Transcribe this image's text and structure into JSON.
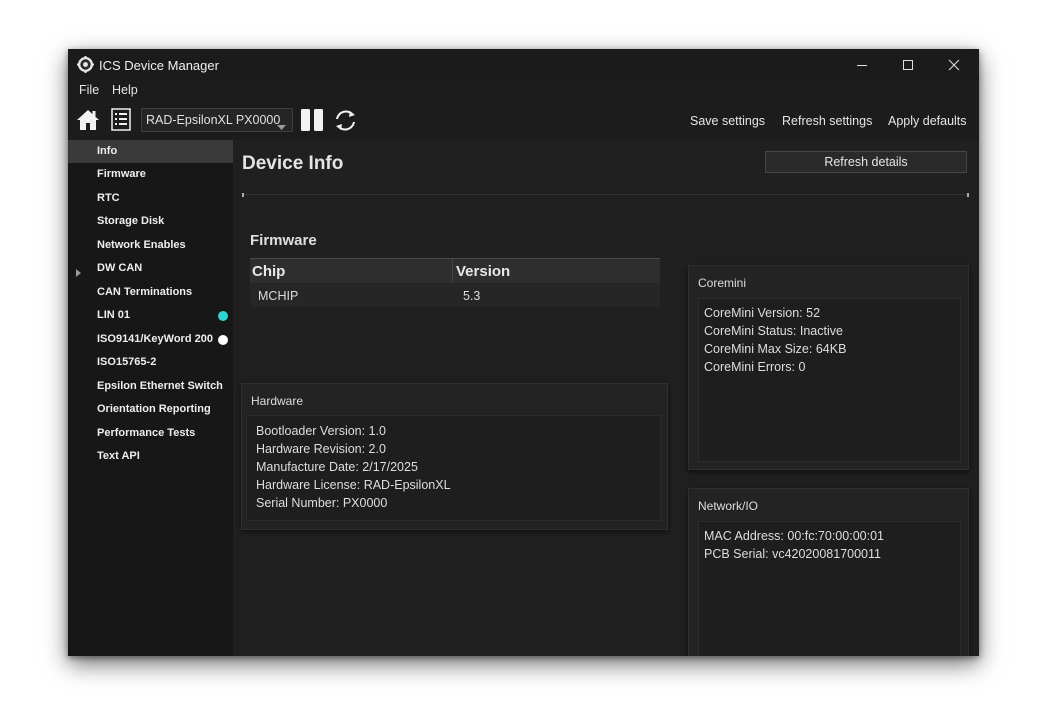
{
  "window": {
    "title": "ICS Device Manager"
  },
  "menu": {
    "file": "File",
    "help": "Help"
  },
  "toolbar": {
    "device": "RAD-EpsilonXL PX0000",
    "save_settings": "Save settings",
    "refresh_settings": "Refresh settings",
    "apply_defaults": "Apply defaults"
  },
  "sidebar": {
    "items": [
      {
        "label": "Info"
      },
      {
        "label": "Firmware"
      },
      {
        "label": "RTC"
      },
      {
        "label": "Storage Disk"
      },
      {
        "label": "Network Enables"
      },
      {
        "label": "DW CAN"
      },
      {
        "label": "CAN Terminations"
      },
      {
        "label": "LIN 01"
      },
      {
        "label": "ISO9141/KeyWord 200"
      },
      {
        "label": "ISO15765-2"
      },
      {
        "label": "Epsilon Ethernet Switch"
      },
      {
        "label": "Orientation Reporting"
      },
      {
        "label": "Performance Tests"
      },
      {
        "label": "Text API"
      }
    ],
    "lin_status_color": "#2ed3d3",
    "iso_status_color": "#ffffff"
  },
  "main": {
    "title": "Device Info",
    "refresh_details": "Refresh details",
    "firmware": {
      "title": "Firmware",
      "headers": [
        "Chip",
        "Version"
      ],
      "rows": [
        {
          "chip": "MCHIP",
          "version": "5.3"
        }
      ]
    },
    "hardware": {
      "title": "Hardware",
      "lines": [
        "Bootloader Version: 1.0",
        "Hardware Revision: 2.0",
        "Manufacture Date: 2/17/2025",
        "Hardware License: RAD-EpsilonXL",
        "Serial Number: PX0000"
      ]
    },
    "coremini": {
      "title": "Coremini",
      "lines": [
        "CoreMini Version: 52",
        "CoreMini Status: Inactive",
        "CoreMini Max Size: 64KB",
        "CoreMini Errors: 0"
      ]
    },
    "network": {
      "title": "Network/IO",
      "lines": [
        "MAC Address: 00:fc:70:00:00:01",
        "PCB Serial: vc42020081700011"
      ]
    }
  }
}
